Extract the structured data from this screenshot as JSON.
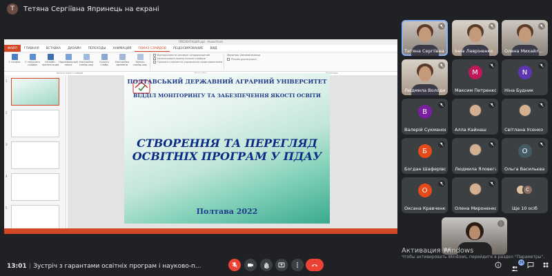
{
  "presenter": {
    "initial": "Т",
    "label": "Тетяна Сергіївна Япринець на екрані"
  },
  "ppt": {
    "window_title": "ПРЕЗЕНТАЦИЯ.ppt - PowerPoint",
    "tabs": [
      "ФАЙЛ",
      "ГЛАВНАЯ",
      "ВСТАВКА",
      "ДИЗАЙН",
      "ПЕРЕХОДЫ",
      "АНИМАЦИЯ",
      "ПОКАЗ СЛАЙДОВ",
      "РЕЦЕНЗИРОВАНИЕ",
      "ВИД"
    ],
    "ribbon_buttons": [
      "С начала",
      "С текущего слайда",
      "Онлайн-презентация",
      "Произвольный показ",
      "Настройка слайд-шоу",
      "Скрыть слайд",
      "Настройка времени",
      "Запись слайд-шоу"
    ],
    "ribbon_checks": [
      "Воспроизвести речевое сопровождение",
      "Использовать время показа слайдов",
      "Показать элементы управления проигрывателем"
    ],
    "monitor_label": "Монитор:",
    "monitor_value": "Автоматически",
    "presenter_view": "Режим докладчика",
    "groups": [
      "Начать показ слайдов",
      "Настройка",
      "Мониторы"
    ]
  },
  "slide": {
    "university": "ПОЛТАВСЬКИЙ ДЕРЖАВНИЙ АГРАРНИЙ УНІВЕРСИТЕТ",
    "department": "ВІДДІЛ МОНІТОРИНГУ ТА ЗАБЕЗПЕЧЕННЯ ЯКОСТІ ОСВІТИ",
    "title_line1": "СТВОРЕННЯ ТА ПЕРЕГЛЯД",
    "title_line2": "ОСВІТНІХ ПРОГРАМ У ПДАУ",
    "footer": "Полтава 2022"
  },
  "participants": [
    {
      "name": "Тетяна Сергіївна",
      "type": "photo",
      "active": true
    },
    {
      "name": "Інна Лавріненко",
      "type": "photo"
    },
    {
      "name": "Олена Михайл...",
      "type": "photo"
    },
    {
      "name": "Людмила Володи...",
      "type": "photo"
    },
    {
      "name": "Максим Петренко",
      "type": "avatar",
      "initial": "М",
      "color": "#c2185b"
    },
    {
      "name": "Ніна Будник",
      "type": "avatar",
      "initial": "N",
      "color": "#5e35b1"
    },
    {
      "name": "Валерій Сукманов",
      "type": "avatar",
      "initial": "В",
      "color": "#7b1fa2"
    },
    {
      "name": "Алла Кайнаш",
      "type": "mini"
    },
    {
      "name": "Світлана Усенко",
      "type": "mini"
    },
    {
      "name": "Богдан Шаферівс...",
      "type": "avatar",
      "initial": "Б",
      "color": "#e64a19"
    },
    {
      "name": "Людмила Яловега",
      "type": "mini"
    },
    {
      "name": "Ольга Васильєва",
      "type": "avatar",
      "initial": "О",
      "color": "#455a64"
    },
    {
      "name": "Оксана Кравченко",
      "type": "avatar",
      "initial": "О",
      "color": "#e64a19"
    },
    {
      "name": "Олена Мироненко",
      "type": "mini"
    },
    {
      "name": "Ще 10 осіб",
      "type": "more",
      "initial": "С"
    }
  ],
  "self_view": {
    "label": "Ви"
  },
  "activation": {
    "title": "Активация Windows",
    "subtitle": "Чтобы активировать Windows, перейдите в раздел \"Параметры\"."
  },
  "bottom": {
    "time": "13:01",
    "meeting_title": "Зустріч з гарантами освітніх програм і науково-п...",
    "people_count": "26",
    "colors": {
      "end_call": "#ea4335",
      "mic_off": "#ea4335"
    }
  }
}
